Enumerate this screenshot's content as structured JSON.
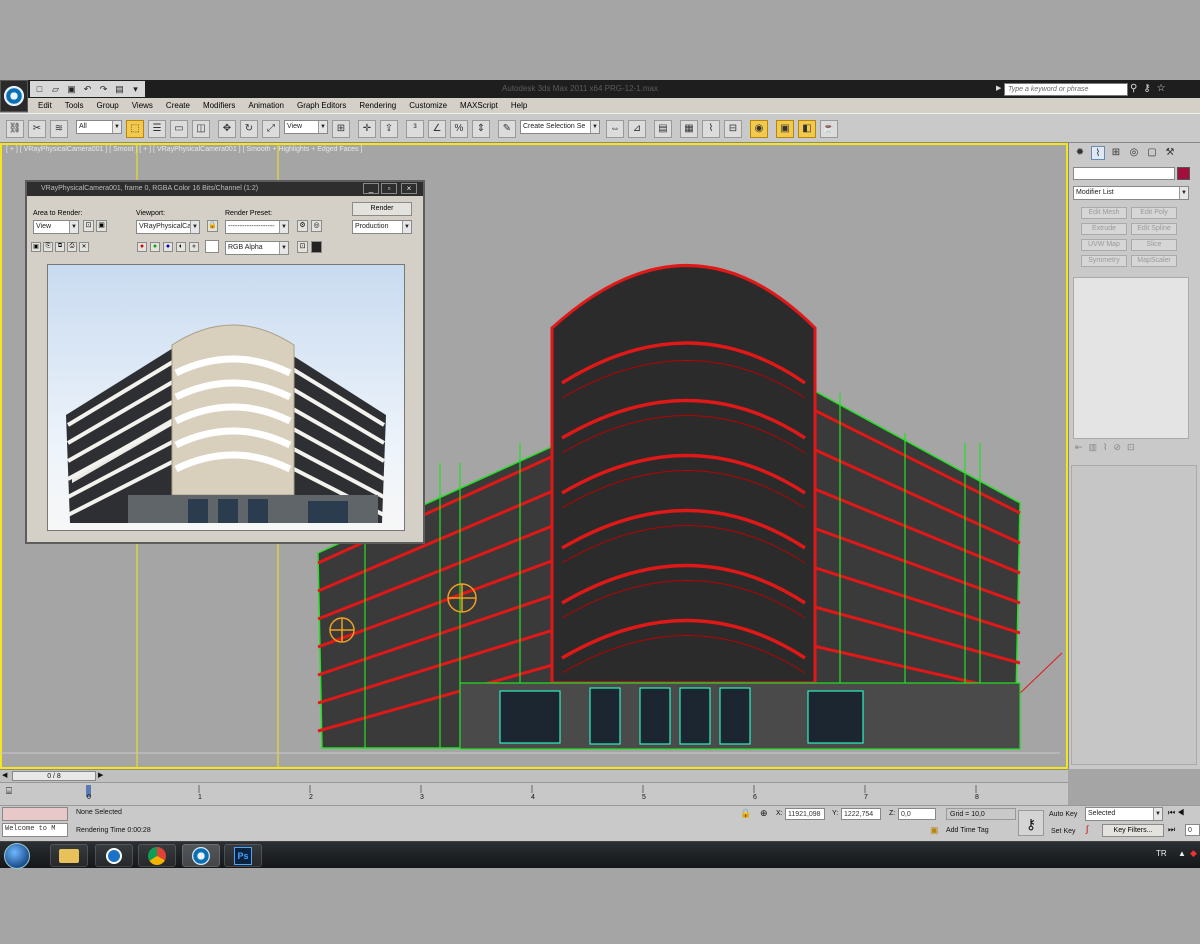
{
  "window": {
    "title": "Autodesk 3ds Max 2011 x64    PRG-12-1.max",
    "search_placeholder": "Type a keyword or phrase"
  },
  "menu": [
    "Edit",
    "Tools",
    "Group",
    "Views",
    "Create",
    "Modifiers",
    "Animation",
    "Graph Editors",
    "Rendering",
    "Customize",
    "MAXScript",
    "Help"
  ],
  "toolbar": {
    "selection_filter": "All",
    "reference_coord": "View",
    "named_selection": "Create Selection Se"
  },
  "viewport": {
    "label": "[ + ] [ VRayPhysicalCamera001 ] [ Smoot ] [ + ] [ VRayPhysicalCamera001 ] [ Smooth + Highlights + Edged Faces ]"
  },
  "render_window": {
    "title": "VRayPhysicalCamera001, frame 0, RGBA Color 16 Bits/Channel (1:2)",
    "area_to_render_label": "Area to Render:",
    "area_to_render_value": "View",
    "viewport_label": "Viewport:",
    "viewport_value": "VRayPhysicalCam",
    "render_preset_label": "Render Preset:",
    "render_preset_value": "--------------------",
    "render_button": "Render",
    "production_value": "Production",
    "channel_value": "RGB Alpha"
  },
  "command_panel": {
    "modifier_list": "Modifier List",
    "modifier_buttons": [
      "Edit Mesh",
      "Edit Poly",
      "Extrude",
      "Edit Spline",
      "UVW Map",
      "Slice",
      "Symmetry",
      "MapScaler"
    ]
  },
  "timeline": {
    "frame_counter": "0 / 8",
    "ticks": [
      "0",
      "1",
      "2",
      "3",
      "4",
      "5",
      "6",
      "7",
      "8"
    ]
  },
  "status": {
    "selection": "None Selected",
    "render_time": "Rendering Time  0:00:28",
    "maxscript_listener": "Welcome to M",
    "x_label": "X:",
    "x_value": "11921,098",
    "y_label": "Y:",
    "y_value": "1222,754",
    "z_label": "Z:",
    "z_value": "0,0",
    "grid": "Grid = 10,0",
    "add_time_tag": "Add Time Tag",
    "auto_key": "Auto Key",
    "set_key": "Set Key",
    "key_mode": "Selected",
    "key_filters": "Key Filters...",
    "frame_field": "0"
  },
  "taskbar": {
    "language": "TR"
  },
  "colors": {
    "viewport_border": "#f3e61a",
    "wire_red": "#e01818",
    "wire_green": "#22e022"
  }
}
